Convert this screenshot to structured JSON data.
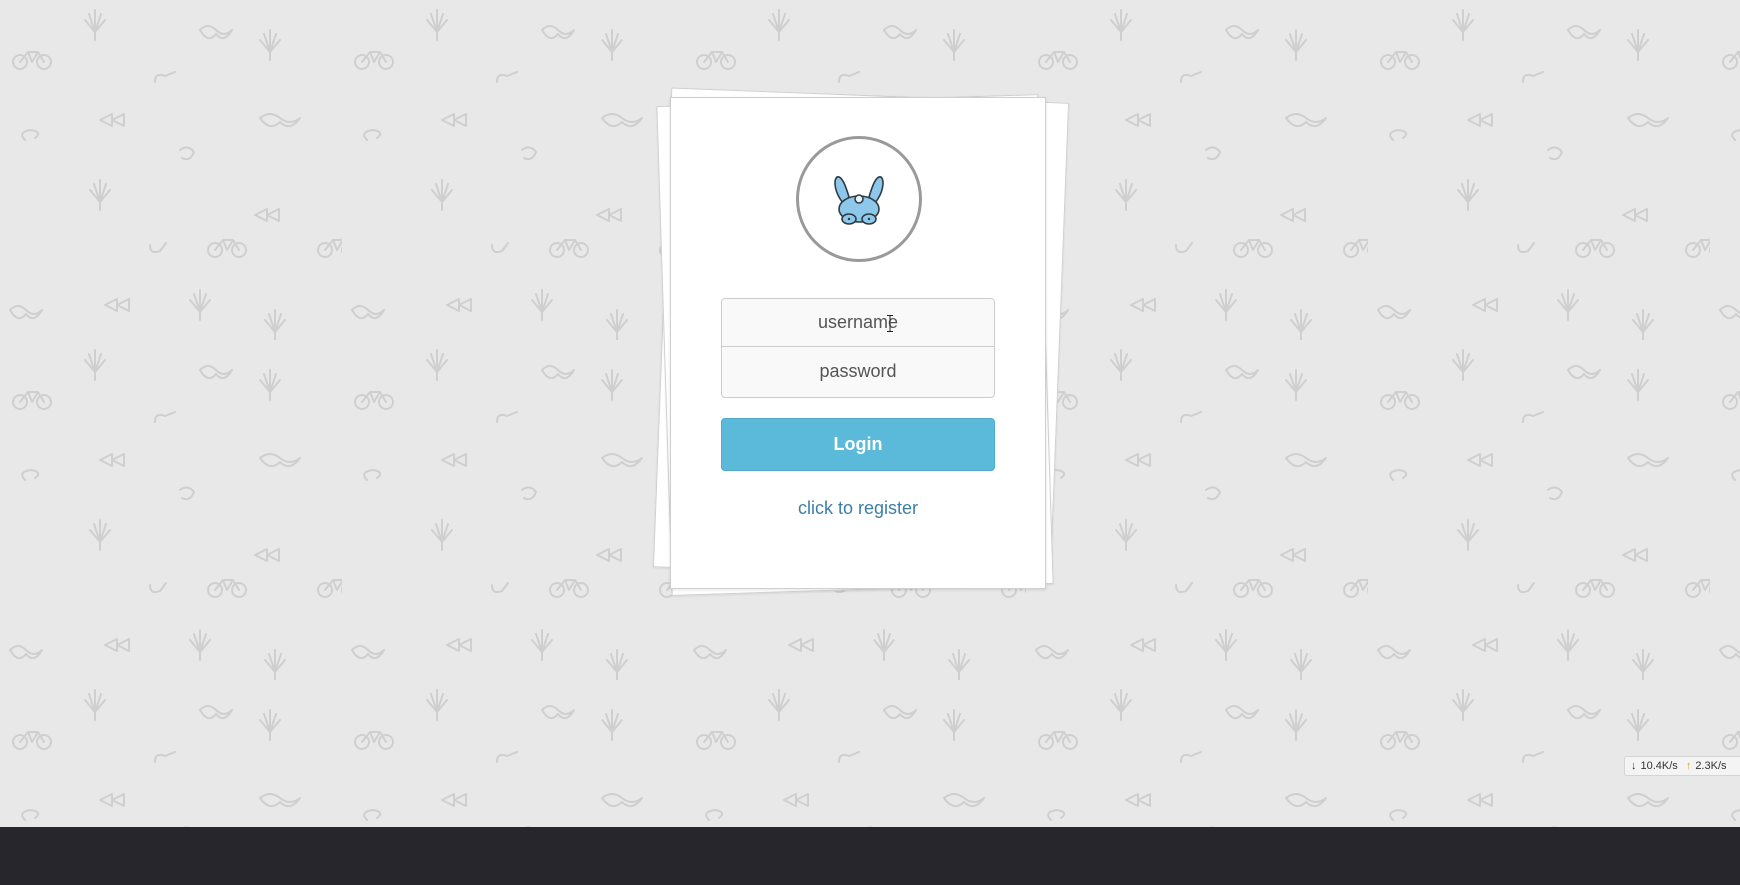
{
  "login": {
    "username_placeholder": "username",
    "password_placeholder": "password",
    "login_label": "Login",
    "register_label": "click to register"
  },
  "avatar": {
    "icon": "bunny-icon",
    "color": "#8dc8ea"
  },
  "network_monitor": {
    "download": "10.4K/s",
    "upload": "2.3K/s"
  },
  "colors": {
    "background": "#e8e8e8",
    "button": "#5bb9d9",
    "link": "#3b7fa8",
    "taskbar": "#27262c"
  }
}
